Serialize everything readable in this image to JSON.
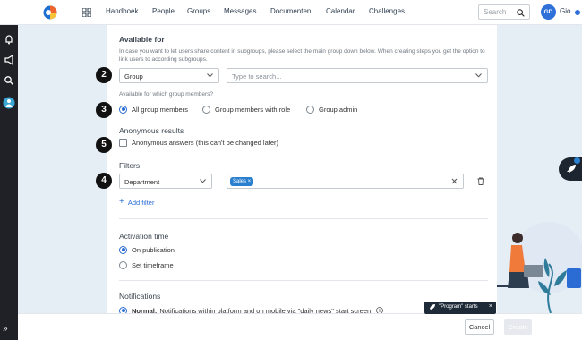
{
  "nav": {
    "items": [
      "Handboek",
      "People",
      "Groups",
      "Messages",
      "Documenten",
      "Calendar",
      "Challenges"
    ],
    "search_placeholder": "Search",
    "avatar_initials": "GD",
    "user_name": "Gio"
  },
  "available_for": {
    "title": "Available for",
    "help": "In case you want to let users share content in subgroups, please select the main group down below. When creating steps you get the option to link users to according subgroups.",
    "group_select_value": "Group",
    "group_search_placeholder": "Type to search...",
    "members_label": "Available for which group members?",
    "options": [
      "All group members",
      "Group members with role",
      "Group admin"
    ],
    "selected_option": "All group members"
  },
  "anonymous": {
    "title": "Anonymous results",
    "checkbox_label": "Anonymous answers (this can't be changed later)",
    "checked": false
  },
  "filters": {
    "title": "Filters",
    "field_value": "Department",
    "tag": "Sales ×",
    "add_label": "Add filter"
  },
  "activation": {
    "title": "Activation time",
    "options": [
      "On publication",
      "Set timeframe"
    ],
    "selected_option": "On publication"
  },
  "notifications": {
    "title": "Notifications",
    "option_bold": "Normal:",
    "option_text": "Notifications within platform and on mobile via \"daily news\" start screen."
  },
  "steps": [
    "2",
    "3",
    "5",
    "4"
  ],
  "footer": {
    "cancel_label": "Cancel",
    "create_label": "Create"
  },
  "toast": {
    "text": "\"Program\" starts",
    "close": "×"
  },
  "colors": {
    "accent": "#2a6cd3",
    "tag": "#2a7fcf",
    "rail": "#1f2126",
    "background": "#e5eef5"
  }
}
